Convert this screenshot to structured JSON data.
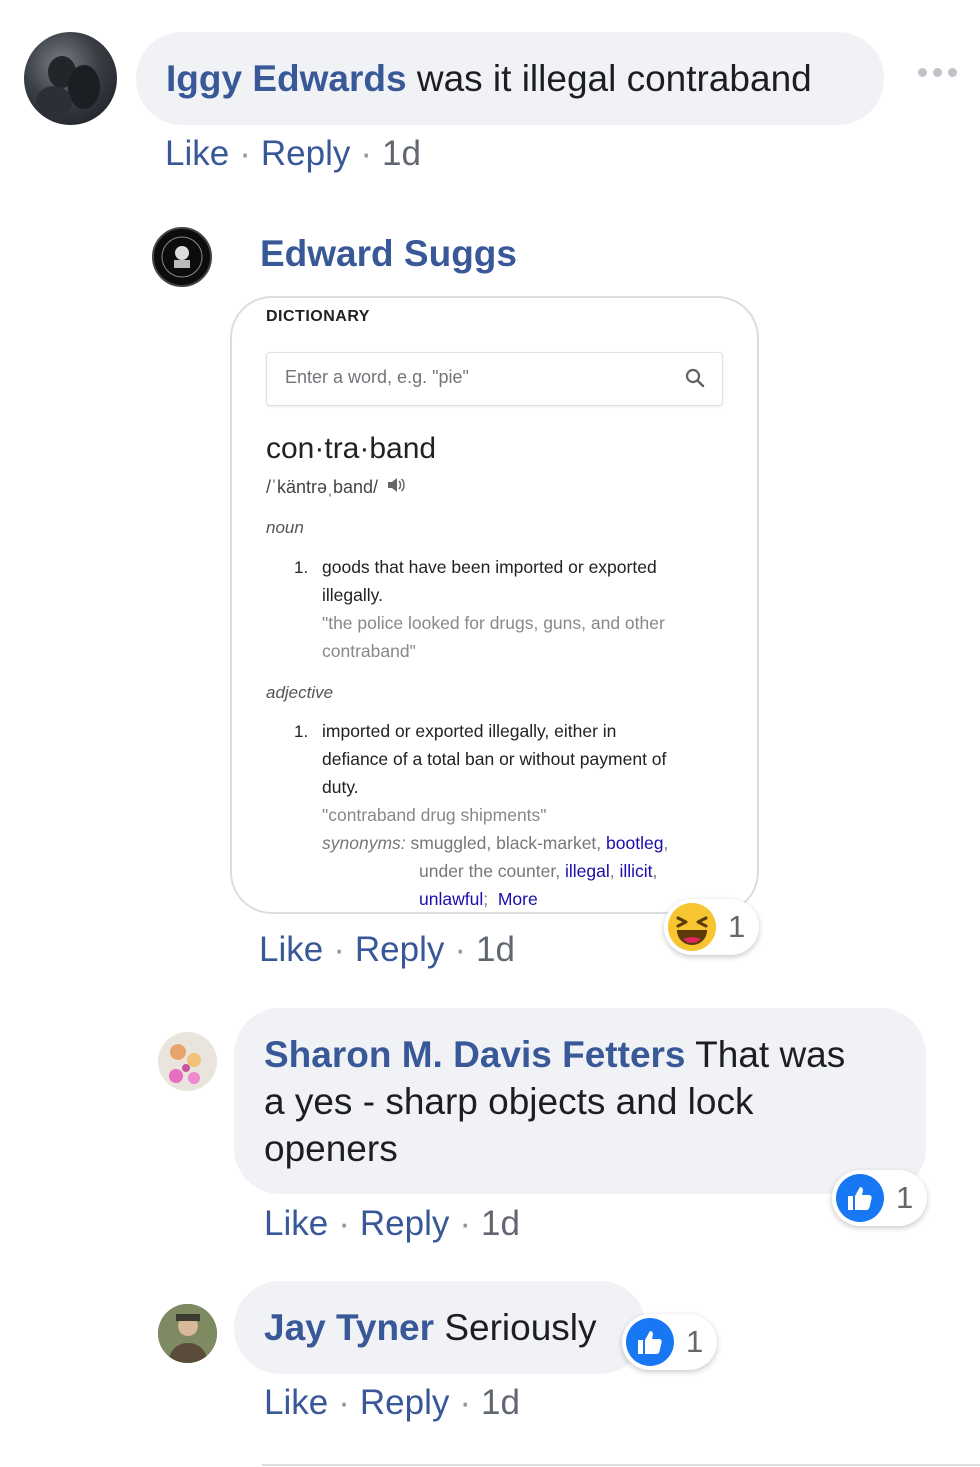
{
  "comments": [
    {
      "author": "Iggy Edwards",
      "text": "was it illegal contraband",
      "actions": {
        "like": "Like",
        "reply": "Reply",
        "time": "1d"
      }
    },
    {
      "author": "Edward Suggs",
      "actions": {
        "like": "Like",
        "reply": "Reply",
        "time": "1d"
      },
      "reaction": {
        "icon": "laughing-emoji-icon",
        "count": "1"
      },
      "attachment": {
        "header": "DICTIONARY",
        "search_placeholder": "Enter a word, e.g. \"pie\"",
        "word": "con·tra·band",
        "pronunciation": "/ˈkäntrəˌband/",
        "noun": {
          "label": "noun",
          "number": "1.",
          "definition_line1": "goods that have been imported or exported",
          "definition_line2": "illegally.",
          "example_line1": "\"the police looked for drugs, guns, and other",
          "example_line2": "contraband\""
        },
        "adjective": {
          "label": "adjective",
          "number": "1.",
          "definition_line1": "imported or exported illegally, either in",
          "definition_line2": "defiance of a total ban or without payment of",
          "definition_line3": "duty.",
          "example": "\"contraband drug shipments\"",
          "synonyms_label": "synonyms:",
          "syn_plain1": "smuggled, black-market,",
          "syn_link1": "bootleg",
          "syn_plain2": "under the counter,",
          "syn_link2": "illegal",
          "syn_link3": "illicit",
          "syn_link4": "unlawful",
          "more": "More"
        }
      }
    },
    {
      "author": "Sharon M. Davis Fetters",
      "text_line1": "That was",
      "text_line2": "a yes - sharp objects and lock",
      "text_line3": "openers",
      "actions": {
        "like": "Like",
        "reply": "Reply",
        "time": "1d"
      },
      "reaction": {
        "icon": "like-thumb-icon",
        "count": "1"
      }
    },
    {
      "author": "Jay Tyner",
      "text": "Seriously",
      "actions": {
        "like": "Like",
        "reply": "Reply",
        "time": "1d"
      },
      "reaction": {
        "icon": "like-thumb-icon",
        "count": "1"
      }
    }
  ],
  "colors": {
    "author": "#385898",
    "bubble": "#f0f2f5",
    "like_blue": "#1877f2",
    "link": "#1a0dab"
  }
}
